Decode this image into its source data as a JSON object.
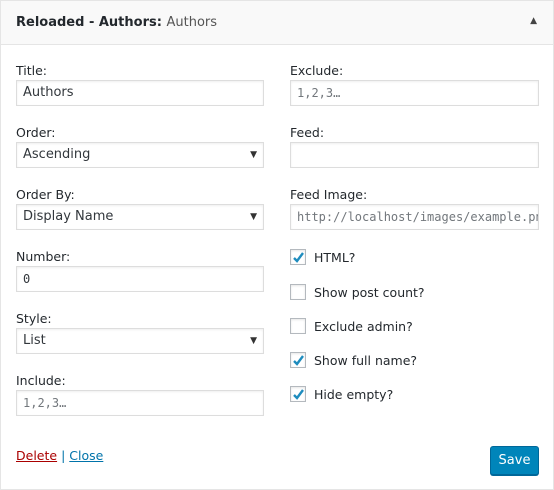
{
  "header": {
    "title": "Reloaded - Authors:",
    "subtitle": "Authors",
    "toggle_icon": "triangle-up-icon"
  },
  "left": {
    "title": {
      "label": "Title:",
      "value": "Authors"
    },
    "order": {
      "label": "Order:",
      "value": "Ascending"
    },
    "order_by": {
      "label": "Order By:",
      "value": "Display Name"
    },
    "number": {
      "label": "Number:",
      "value": "0"
    },
    "style": {
      "label": "Style:",
      "value": "List"
    },
    "include": {
      "label": "Include:",
      "placeholder": "1,2,3…"
    }
  },
  "right": {
    "exclude": {
      "label": "Exclude:",
      "placeholder": "1,2,3…"
    },
    "feed": {
      "label": "Feed:",
      "value": ""
    },
    "feed_image": {
      "label": "Feed Image:",
      "placeholder": "http://localhost/images/example.png"
    },
    "checkboxes": [
      {
        "label": "HTML?",
        "checked": true
      },
      {
        "label": "Show post count?",
        "checked": false
      },
      {
        "label": "Exclude admin?",
        "checked": false
      },
      {
        "label": "Show full name?",
        "checked": true
      },
      {
        "label": "Hide empty?",
        "checked": true
      }
    ]
  },
  "footer": {
    "delete": "Delete",
    "separator": "|",
    "close": "Close",
    "save": "Save"
  },
  "colors": {
    "accent": "#0085ba",
    "delete": "#aa0000",
    "link": "#0073aa"
  }
}
